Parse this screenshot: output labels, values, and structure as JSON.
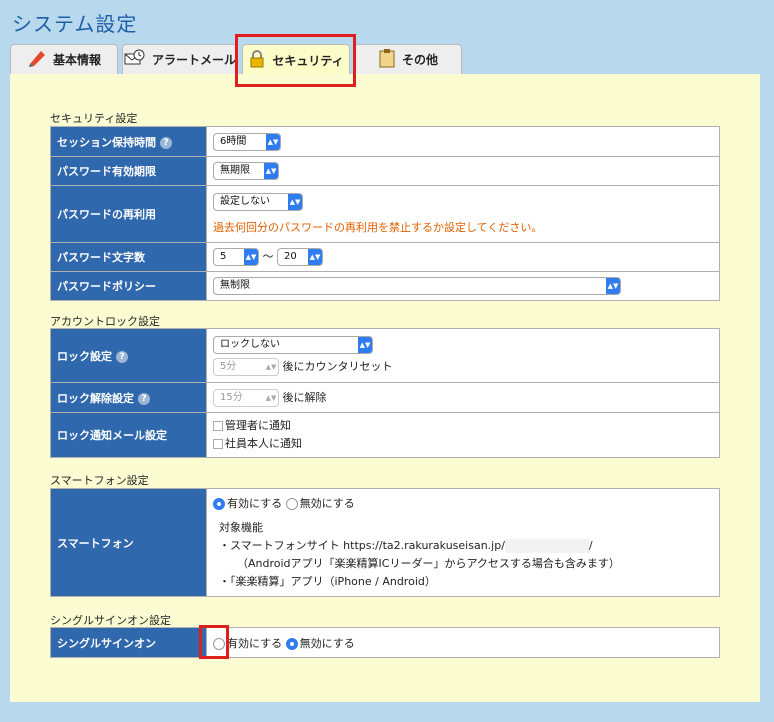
{
  "page": {
    "title": "システム設定"
  },
  "tabs": [
    {
      "label": "基本情報",
      "icon": "pencil-icon"
    },
    {
      "label": "アラートメール",
      "icon": "mail-clock-icon"
    },
    {
      "label": "セキュリティ",
      "icon": "lock-icon",
      "active": true
    },
    {
      "label": "その他",
      "icon": "clipboard-icon"
    }
  ],
  "security": {
    "section_title": "セキュリティ設定",
    "session": {
      "label": "セッション保持時間",
      "value": "6時間"
    },
    "pw_expiry": {
      "label": "パスワード有効期限",
      "value": "無期限"
    },
    "pw_reuse": {
      "label": "パスワードの再利用",
      "value": "設定しない",
      "note": "過去何回分のパスワードの再利用を禁止するか設定してください。"
    },
    "pw_length": {
      "label": "パスワード文字数",
      "min": "5",
      "sep": "〜",
      "max": "20"
    },
    "pw_policy": {
      "label": "パスワードポリシー",
      "value": "無制限"
    }
  },
  "lock": {
    "section_title": "アカウントロック設定",
    "setting": {
      "label": "ロック設定",
      "value": "ロックしない",
      "reset_value": "5分",
      "reset_suffix": "後にカウンタリセット"
    },
    "release": {
      "label": "ロック解除設定",
      "value": "15分",
      "suffix": "後に解除"
    },
    "notify": {
      "label": "ロック通知メール設定",
      "opt_admin": "管理者に通知",
      "opt_self": "社員本人に通知"
    }
  },
  "smartphone": {
    "section_title": "スマートフォン設定",
    "label": "スマートフォン",
    "enable": "有効にする",
    "disable": "無効にする",
    "features_title": "対象機能",
    "feature1": "・スマートフォンサイト https://ta2.rakurakuseisan.jp/",
    "feature1_end": "/",
    "feature1_note": "（Androidアプリ「楽楽精算ICリーダー」からアクセスする場合も含みます）",
    "feature2": "・「楽楽精算」アプリ（iPhone / Android）"
  },
  "sso": {
    "section_title": "シングルサインオン設定",
    "label": "シングルサインオン",
    "enable": "有効にする",
    "disable": "無効にする"
  }
}
